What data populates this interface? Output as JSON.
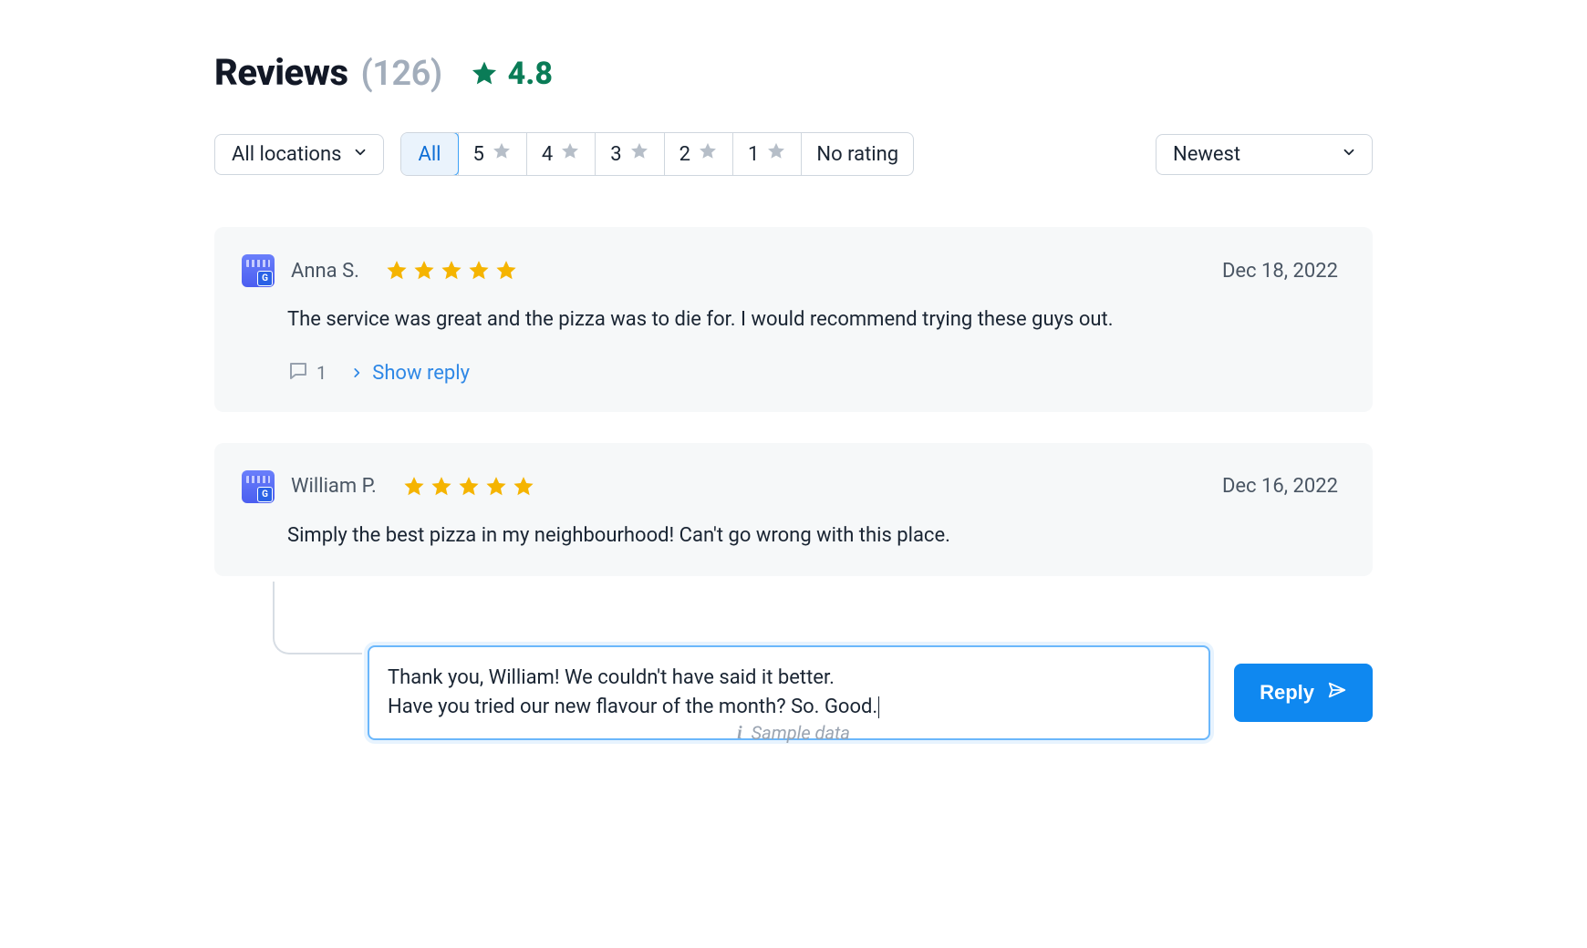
{
  "header": {
    "title": "Reviews",
    "count_display": "(126)",
    "avg_rating": "4.8"
  },
  "filters": {
    "location_selected": "All locations",
    "segments": {
      "all": "All",
      "r5": "5",
      "r4": "4",
      "r3": "3",
      "r2": "2",
      "r1": "1",
      "none": "No rating"
    },
    "sort_selected": "Newest"
  },
  "reviews": [
    {
      "author": "Anna S.",
      "date": "Dec 18, 2022",
      "rating": 5,
      "text": "The service was great and the pizza was to die for. I would recommend trying these guys out.",
      "reply_count": "1",
      "show_reply_label": "Show reply"
    },
    {
      "author": "William P.",
      "date": "Dec 16, 2022",
      "rating": 5,
      "text": "Simply the best pizza in my neighbourhood! Can't go wrong with this place."
    }
  ],
  "reply_box": {
    "text": "Thank you, William! We couldn't have said it better.\nHave you tried our new flavour of the month? So. Good.",
    "button_label": "Reply"
  },
  "footer": {
    "note": "Sample data"
  }
}
